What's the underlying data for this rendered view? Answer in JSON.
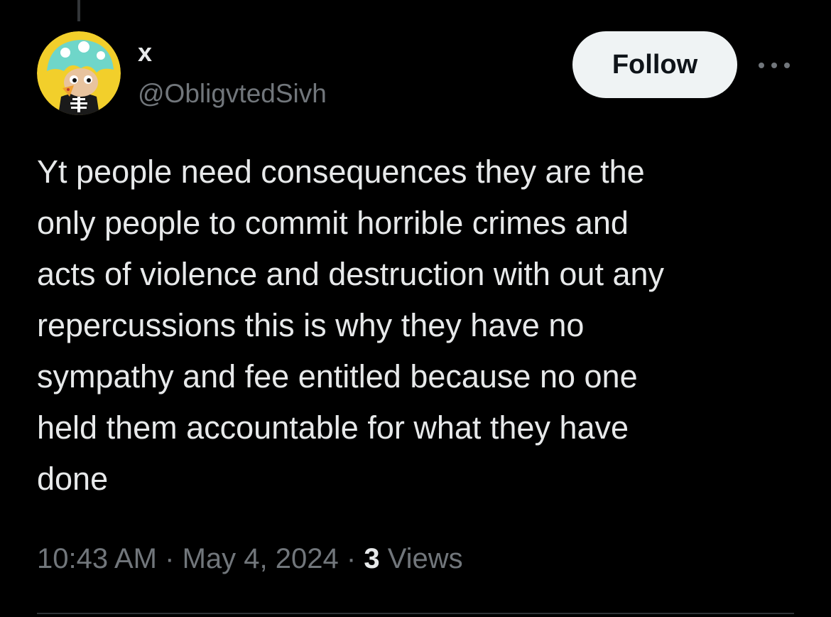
{
  "tweet": {
    "author": {
      "display_name": "x",
      "handle": "@ObligvtedSivh",
      "avatar_icon": "mushroom-cartoon-avatar-icon"
    },
    "follow_label": "Follow",
    "more_icon": "more-horizontal-icon",
    "text": "Yt people need consequences they are the\nonly people to commit horrible crimes and\nacts of violence and destruction with out any\nrepercussions this is why they have no\nsympathy and fee entitled because no one\nheld them accountable for what they have\ndone",
    "time": "10:43 AM",
    "separator": "·",
    "date": "May 4, 2024",
    "views_count": "3",
    "views_label": "Views"
  },
  "colors": {
    "background": "#000000",
    "primary_text": "#e7e9ea",
    "secondary_text": "#71767b",
    "follow_button_bg": "#eff3f4",
    "follow_button_text": "#0f1419"
  }
}
